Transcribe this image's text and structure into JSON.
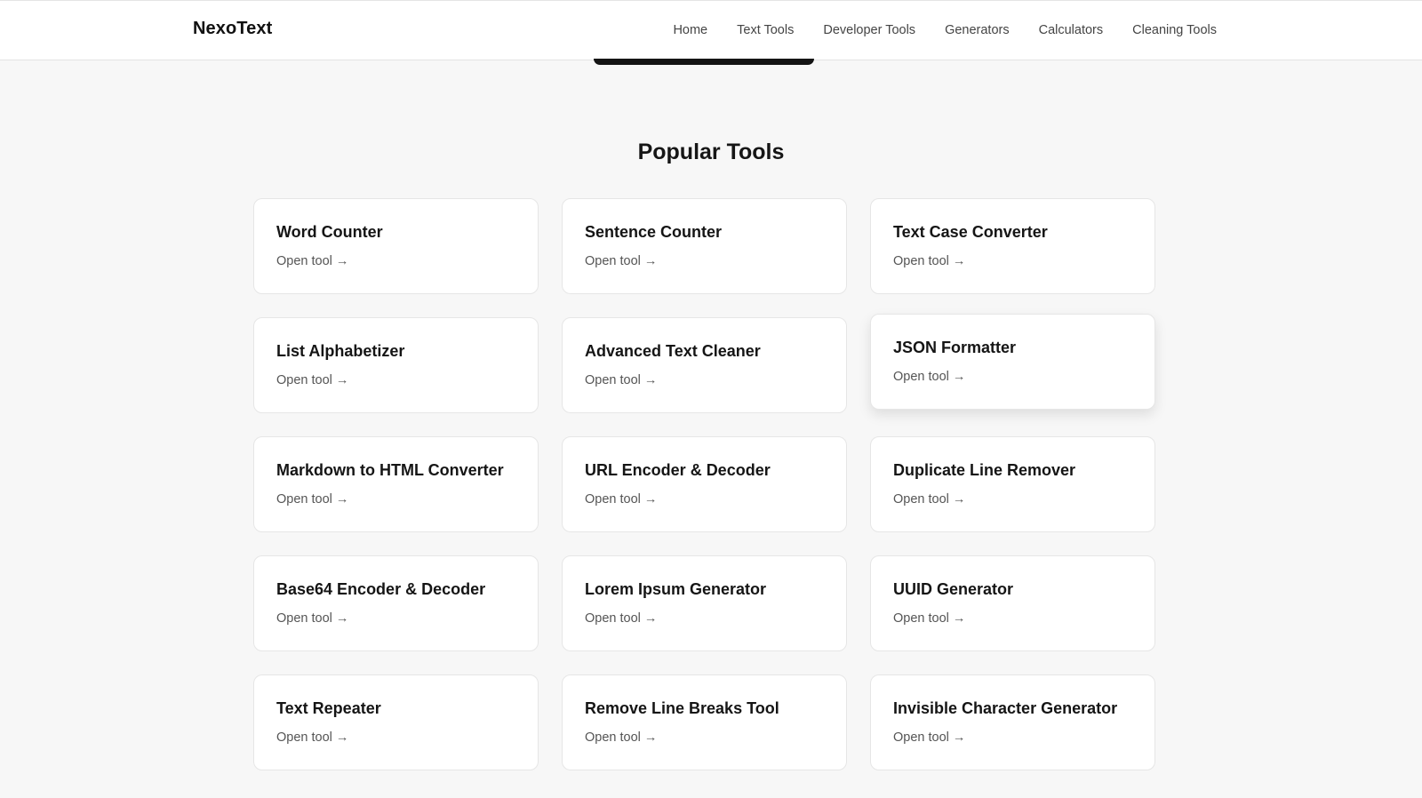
{
  "header": {
    "brand": "NexoText",
    "nav": [
      {
        "label": "Home"
      },
      {
        "label": "Text Tools"
      },
      {
        "label": "Developer Tools"
      },
      {
        "label": "Generators"
      },
      {
        "label": "Calculators"
      },
      {
        "label": "Cleaning Tools"
      }
    ]
  },
  "section": {
    "title": "Popular Tools",
    "link_label": "Open tool",
    "arrow": "→",
    "tools": [
      {
        "name": "Word Counter"
      },
      {
        "name": "Sentence Counter"
      },
      {
        "name": "Text Case Converter"
      },
      {
        "name": "List Alphabetizer"
      },
      {
        "name": "Advanced Text Cleaner"
      },
      {
        "name": "JSON Formatter",
        "state": "hovered"
      },
      {
        "name": "Markdown to HTML Converter"
      },
      {
        "name": "URL Encoder & Decoder"
      },
      {
        "name": "Duplicate Line Remover"
      },
      {
        "name": "Base64 Encoder & Decoder"
      },
      {
        "name": "Lorem Ipsum Generator"
      },
      {
        "name": "UUID Generator"
      },
      {
        "name": "Text Repeater"
      },
      {
        "name": "Remove Line Breaks Tool"
      },
      {
        "name": "Invisible Character Generator"
      }
    ]
  }
}
